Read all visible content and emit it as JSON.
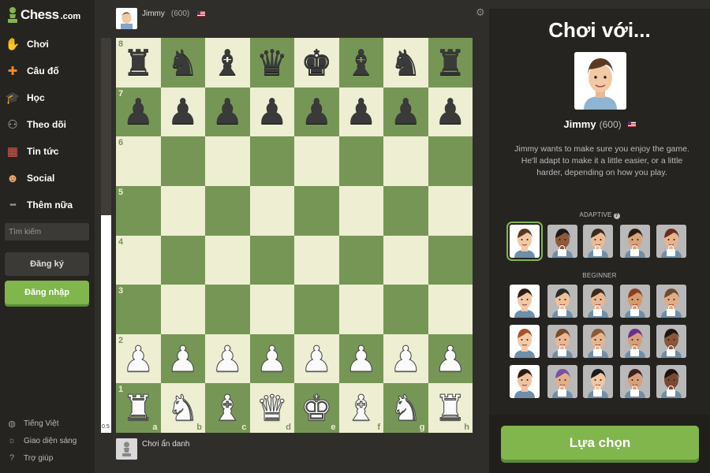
{
  "logo": {
    "text": "Chess",
    "domain": ".com"
  },
  "nav": [
    {
      "label": "Chơi",
      "icon": "play-hand-icon",
      "glyph": "✋",
      "color": "#f3d7b7"
    },
    {
      "label": "Câu đố",
      "icon": "puzzle-icon",
      "glyph": "✚",
      "color": "#f28b2c"
    },
    {
      "label": "Học",
      "icon": "graduation-cap-icon",
      "glyph": "🎓",
      "color": "#5b9bd5"
    },
    {
      "label": "Theo dõi",
      "icon": "binoculars-icon",
      "glyph": "⚇",
      "color": "#bbbbbb"
    },
    {
      "label": "Tin tức",
      "icon": "news-calendar-icon",
      "glyph": "▦",
      "color": "#e05a4d"
    },
    {
      "label": "Social",
      "icon": "social-people-icon",
      "glyph": "☻",
      "color": "#e8a86a"
    },
    {
      "label": "Thêm nữa",
      "icon": "more-dots-icon",
      "glyph": "•••",
      "color": "#999999"
    }
  ],
  "search": {
    "placeholder": "Tìm kiếm"
  },
  "signup_label": "Đăng ký",
  "login_label": "Đăng nhập",
  "footer": [
    {
      "label": "Tiếng Việt",
      "icon": "globe-icon",
      "glyph": "◍"
    },
    {
      "label": "Giao diện sáng",
      "icon": "sun-icon",
      "glyph": "☼"
    },
    {
      "label": "Trợ giúp",
      "icon": "help-icon",
      "glyph": "?"
    }
  ],
  "opponent": {
    "name": "Jimmy",
    "rating": "(600)"
  },
  "me": {
    "name": "Chơi ẩn danh"
  },
  "eval": {
    "value": "0.5",
    "white_fraction": 0.55
  },
  "board": {
    "ranks": [
      "8",
      "7",
      "6",
      "5",
      "4",
      "3",
      "2",
      "1"
    ],
    "files": [
      "a",
      "b",
      "c",
      "d",
      "e",
      "f",
      "g",
      "h"
    ],
    "rows": [
      [
        "bR",
        "bN",
        "bB",
        "bQ",
        "bK",
        "bB",
        "bN",
        "bR"
      ],
      [
        "bP",
        "bP",
        "bP",
        "bP",
        "bP",
        "bP",
        "bP",
        "bP"
      ],
      [
        "",
        "",
        "",
        "",
        "",
        "",
        "",
        ""
      ],
      [
        "",
        "",
        "",
        "",
        "",
        "",
        "",
        ""
      ],
      [
        "",
        "",
        "",
        "",
        "",
        "",
        "",
        ""
      ],
      [
        "",
        "",
        "",
        "",
        "",
        "",
        "",
        ""
      ],
      [
        "wP",
        "wP",
        "wP",
        "wP",
        "wP",
        "wP",
        "wP",
        "wP"
      ],
      [
        "wR",
        "wN",
        "wB",
        "wQ",
        "wK",
        "wB",
        "wN",
        "wR"
      ]
    ]
  },
  "panel": {
    "title": "Chơi với...",
    "bot_name": "Jimmy",
    "bot_rating": "(600)",
    "description": "Jimmy wants to make sure you enjoy the game. He'll adapt to make it a little easier, or a little harder, depending on how you play.",
    "adaptive_label": "ADAPTIVE",
    "beginner_label": "BEGINNER",
    "choose_label": "Lựa chọn"
  },
  "adaptive_bots": [
    {
      "skin": "#f1c9a5",
      "hair": "#5b3a24",
      "bg": "#ffffff",
      "selected": true,
      "locked": false
    },
    {
      "skin": "#8d5a3b",
      "hair": "#1e1a18",
      "bg": "#b9b9b9",
      "selected": false,
      "locked": true
    },
    {
      "skin": "#e9bb95",
      "hair": "#3b2a1f",
      "bg": "#b9b9b9",
      "selected": false,
      "locked": true
    },
    {
      "skin": "#d9a47a",
      "hair": "#2a1d14",
      "bg": "#b9b9b9",
      "selected": false,
      "locked": true
    },
    {
      "skin": "#e7b58d",
      "hair": "#6b2b1d",
      "bg": "#b9b9b9",
      "selected": false,
      "locked": true
    }
  ],
  "beginner_bots": [
    {
      "skin": "#f1c9a5",
      "hair": "#2e2016",
      "bg": "#ffffff",
      "selected": false,
      "locked": false
    },
    {
      "skin": "#efc19b",
      "hair": "#2a2a2a",
      "bg": "#b9b9b9",
      "selected": false,
      "locked": true
    },
    {
      "skin": "#e8b792",
      "hair": "#3c2b1d",
      "bg": "#b9b9b9",
      "selected": false,
      "locked": true
    },
    {
      "skin": "#d79a6c",
      "hair": "#8b3f1f",
      "bg": "#b9b9b9",
      "selected": false,
      "locked": true
    },
    {
      "skin": "#e2ad84",
      "hair": "#6d4c2e",
      "bg": "#b9b9b9",
      "selected": false,
      "locked": true
    },
    {
      "skin": "#f3caa6",
      "hair": "#a8522c",
      "bg": "#ffffff",
      "selected": false,
      "locked": false
    },
    {
      "skin": "#e9b894",
      "hair": "#7b4a26",
      "bg": "#b9b9b9",
      "selected": false,
      "locked": true
    },
    {
      "skin": "#e6b590",
      "hair": "#8a5a36",
      "bg": "#b9b9b9",
      "selected": false,
      "locked": true
    },
    {
      "skin": "#d69f7a",
      "hair": "#6b2f8a",
      "bg": "#b9b9b9",
      "selected": false,
      "locked": true
    },
    {
      "skin": "#8a5638",
      "hair": "#1f1612",
      "bg": "#b9b9b9",
      "selected": false,
      "locked": true
    },
    {
      "skin": "#efc39f",
      "hair": "#2b1d14",
      "bg": "#ffffff",
      "selected": false,
      "locked": false
    },
    {
      "skin": "#e2b08a",
      "hair": "#7b4ea0",
      "bg": "#b9b9b9",
      "selected": false,
      "locked": true
    },
    {
      "skin": "#f0c7a2",
      "hair": "#1b1b1b",
      "bg": "#b9b9b9",
      "selected": false,
      "locked": true
    },
    {
      "skin": "#d8a07a",
      "hair": "#3a2418",
      "bg": "#b9b9b9",
      "selected": false,
      "locked": true
    },
    {
      "skin": "#7a4a30",
      "hair": "#1b1411",
      "bg": "#b9b9b9",
      "selected": false,
      "locked": true
    }
  ]
}
